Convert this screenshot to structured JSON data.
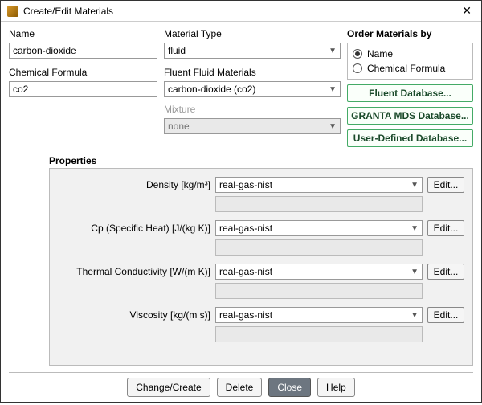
{
  "window": {
    "title": "Create/Edit Materials"
  },
  "left": {
    "name_label": "Name",
    "name_value": "carbon-dioxide",
    "formula_label": "Chemical Formula",
    "formula_value": "co2"
  },
  "mid": {
    "type_label": "Material Type",
    "type_value": "fluid",
    "fluid_label": "Fluent Fluid Materials",
    "fluid_value": "carbon-dioxide (co2)",
    "mixture_label": "Mixture",
    "mixture_value": "none"
  },
  "right": {
    "order_label": "Order Materials by",
    "radio_name": "Name",
    "radio_formula": "Chemical Formula",
    "db_fluent": "Fluent Database...",
    "db_granta": "GRANTA MDS Database...",
    "db_user": "User-Defined Database..."
  },
  "props": {
    "title": "Properties",
    "edit_label": "Edit...",
    "items": [
      {
        "label": "Density [kg/m³]",
        "value": "real-gas-nist"
      },
      {
        "label": "Cp (Specific Heat) [J/(kg K)]",
        "value": "real-gas-nist"
      },
      {
        "label": "Thermal Conductivity [W/(m K)]",
        "value": "real-gas-nist"
      },
      {
        "label": "Viscosity [kg/(m s)]",
        "value": "real-gas-nist"
      }
    ]
  },
  "footer": {
    "change": "Change/Create",
    "delete": "Delete",
    "close": "Close",
    "help": "Help"
  }
}
